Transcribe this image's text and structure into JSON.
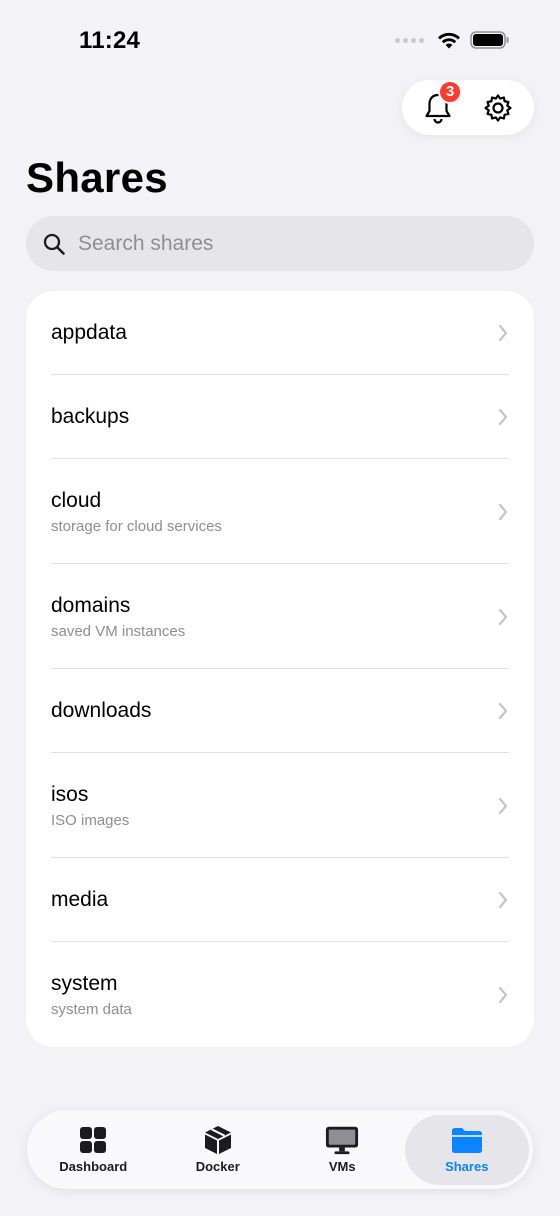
{
  "status_bar": {
    "time": "11:24"
  },
  "header": {
    "notification_count": "3",
    "title": "Shares"
  },
  "search": {
    "placeholder": "Search shares",
    "value": ""
  },
  "shares": [
    {
      "name": "appdata",
      "description": ""
    },
    {
      "name": "backups",
      "description": ""
    },
    {
      "name": "cloud",
      "description": "storage for cloud services"
    },
    {
      "name": "domains",
      "description": "saved VM instances"
    },
    {
      "name": "downloads",
      "description": ""
    },
    {
      "name": "isos",
      "description": "ISO images"
    },
    {
      "name": "media",
      "description": ""
    },
    {
      "name": "system",
      "description": "system data"
    }
  ],
  "tabs": [
    {
      "label": "Dashboard",
      "icon": "grid-icon",
      "active": false
    },
    {
      "label": "Docker",
      "icon": "box-icon",
      "active": false
    },
    {
      "label": "VMs",
      "icon": "monitor-icon",
      "active": false
    },
    {
      "label": "Shares",
      "icon": "folder-icon",
      "active": true
    }
  ],
  "colors": {
    "accent": "#0a84ff",
    "badge": "#ff3b30",
    "background": "#f2f2f7"
  }
}
